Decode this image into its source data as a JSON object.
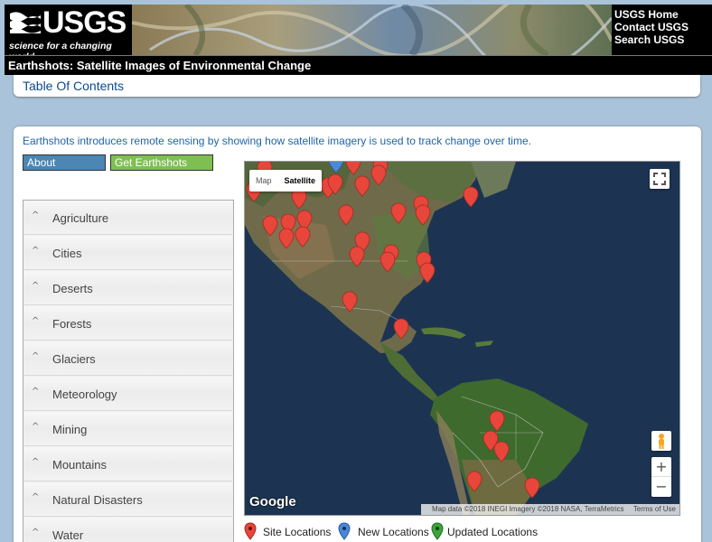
{
  "header": {
    "logo_word": "USGS",
    "logo_tagline": "science for a changing world",
    "links": [
      "USGS Home",
      "Contact USGS",
      "Search USGS"
    ]
  },
  "title_bar": "Earthshots: Satellite Images of Environmental Change",
  "toc_label": "Table Of Contents",
  "intro": "Earthshots introduces remote sensing by showing how satellite imagery is used to track change over time.",
  "buttons": {
    "about": "About Earthshots",
    "cards": "Get Earthshots Cards"
  },
  "menu": [
    "Agriculture",
    "Cities",
    "Deserts",
    "Forests",
    "Glaciers",
    "Meteorology",
    "Mining",
    "Mountains",
    "Natural Disasters",
    "Water"
  ],
  "map": {
    "type_options": [
      "Map",
      "Satellite"
    ],
    "selected_type": "Satellite",
    "google_label": "Google",
    "attribution": "Map data ©2018 INEGI Imagery ©2018 NASA, TerraMetrics",
    "terms": "Terms of Use",
    "zoom_in": "+",
    "zoom_out": "−"
  },
  "legend": {
    "site": "Site Locations",
    "new": "New Locations",
    "updated": "Updated Locations",
    "colors": {
      "site": "#e8463b",
      "new": "#4a88d9",
      "updated": "#3aa63a"
    }
  }
}
